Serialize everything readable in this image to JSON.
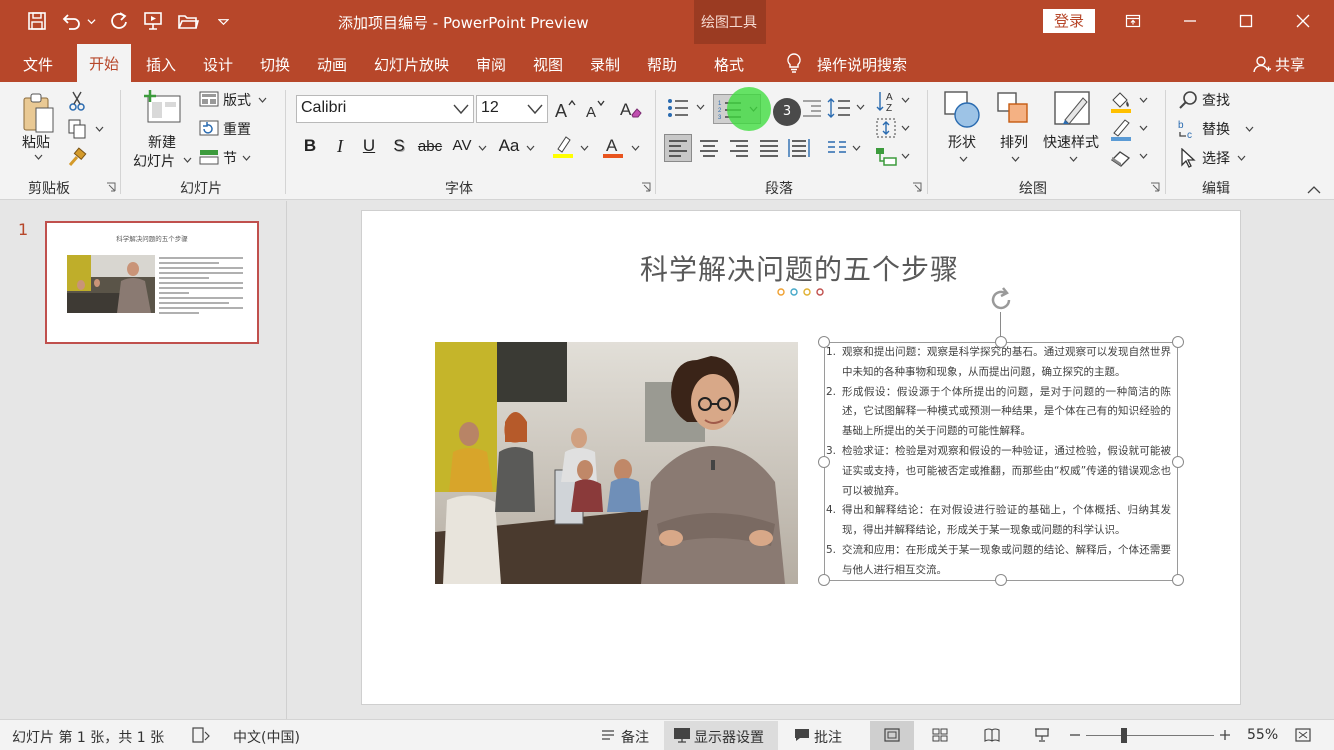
{
  "window": {
    "title": "添加项目编号  -  PowerPoint Preview",
    "context_group": "绘图工具",
    "login": "登录"
  },
  "tabs": [
    "文件",
    "开始",
    "插入",
    "设计",
    "切换",
    "动画",
    "幻灯片放映",
    "审阅",
    "视图",
    "录制",
    "帮助",
    "格式"
  ],
  "tell_me": "操作说明搜索",
  "share": "共享",
  "ribbon": {
    "clipboard": {
      "label": "剪贴板",
      "paste": "粘贴"
    },
    "slides": {
      "label": "幻灯片",
      "new_slide_1": "新建",
      "new_slide_2": "幻灯片",
      "layout": "版式",
      "reset": "重置",
      "section": "节"
    },
    "font": {
      "label": "字体",
      "font_name": "Calibri",
      "font_size": "12",
      "bold": "B",
      "italic": "I",
      "underline": "U",
      "shadow": "S",
      "strike": "abc",
      "spacing": "AV",
      "case": "Aa"
    },
    "paragraph": {
      "label": "段落",
      "numbering_badge": "3"
    },
    "drawing": {
      "label": "绘图",
      "shapes": "形状",
      "arrange": "排列",
      "quick_styles": "快速样式"
    },
    "editing": {
      "label": "编辑",
      "find": "查找",
      "replace": "替换",
      "select": "选择"
    }
  },
  "thumbnail": {
    "number": "1",
    "title": "科学解决问题的五个步骤"
  },
  "slide": {
    "title": "科学解决问题的五个步骤",
    "items": [
      {
        "num": "1.",
        "text": "观察和提出问题：观察是科学探究的基石。通过观察可以发现自然世界中未知的各种事物和现象，从而提出问题，确立探究的主题。"
      },
      {
        "num": "2.",
        "text": "形成假设：假设源于个体所提出的问题，是对于问题的一种简洁的陈述，它试图解释一种模式或预测一种结果，是个体在己有的知识经验的基础上所提出的关于问题的可能性解释。"
      },
      {
        "num": "3.",
        "text": "检验求证：检验是对观察和假设的一种验证，通过检验，假设就可能被证实或支持，也可能被否定或推翻，而那些由“权威”传递的错误观念也可以被抛弃。"
      },
      {
        "num": "4.",
        "text": "得出和解释结论：在对假设进行验证的基础上，个体概括、归纳其发现，得出并解释结论，形成关于某一现象或问题的科学认识。"
      },
      {
        "num": "5.",
        "text": "交流和应用：在形成关于某一现象或问题的结论、解释后，个体还需要与他人进行相互交流。"
      }
    ]
  },
  "status": {
    "slide_info": "幻灯片 第 1 张，共 1 张",
    "language": "中文(中国)",
    "notes": "备注",
    "display": "显示器设置",
    "comments": "批注",
    "zoom": "55%"
  },
  "colors": {
    "accent": "#b7472a",
    "dots": [
      "#f0a030",
      "#45a8c8",
      "#e0b030",
      "#c0504d"
    ]
  }
}
